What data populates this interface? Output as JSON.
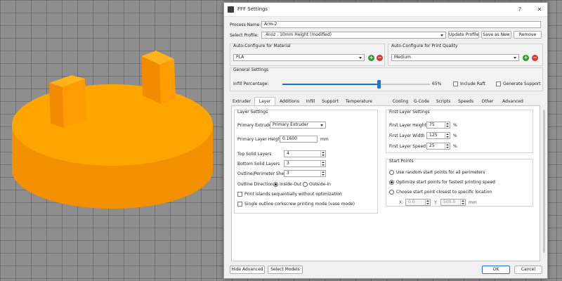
{
  "viewport": {
    "model_color": "#ffa500"
  },
  "window": {
    "title": "FFF Settings",
    "help": "?",
    "minimize": "—",
    "close": "✕"
  },
  "process": {
    "label": "Process Name:",
    "value": "Arm-2"
  },
  "profile": {
    "label": "Select Profile:",
    "value": ".4noz , 10mm Height (modified)",
    "update": "Update Profile",
    "save_as": "Save as New",
    "remove": "Remove"
  },
  "material": {
    "title": "Auto-Configure for Material",
    "value": "PLA"
  },
  "quality": {
    "title": "Auto-Configure for Print Quality",
    "value": "Medium"
  },
  "general": {
    "title": "General Settings",
    "infill_label": "Infill Percentage:",
    "infill_value": "65%",
    "infill_fraction": 0.65,
    "include_raft": "Include Raft",
    "generate_support": "Generate Support"
  },
  "tabs": [
    "Extruder",
    "Layer",
    "Additions",
    "Infill",
    "Support",
    "Temperature",
    "Cooling",
    "G-Code",
    "Scripts",
    "Speeds",
    "Other",
    "Advanced"
  ],
  "layer_settings": {
    "title": "Layer Settings",
    "primary_extruder_label": "Primary Extruder",
    "primary_extruder_value": "Primary Extruder",
    "layer_height_label": "Primary Layer Height",
    "layer_height_value": "0.1600",
    "layer_height_unit": "mm",
    "top_label": "Top Solid Layers",
    "top_value": "4",
    "bottom_label": "Bottom Solid Layers",
    "bottom_value": "3",
    "shells_label": "Outline/Perimeter Shells",
    "shells_value": "3",
    "direction_label": "Outline Direction:",
    "inside_out": "Inside-Out",
    "outside_in": "Outside-In",
    "islands": "Print islands sequentially without optimization",
    "vase": "Single outline corkscrew printing mode (vase mode)"
  },
  "first_layer": {
    "title": "First Layer Settings",
    "height_label": "First Layer Height",
    "height_value": "75",
    "width_label": "First Layer Width",
    "width_value": "125",
    "speed_label": "First Layer Speed",
    "speed_value": "25",
    "unit": "%"
  },
  "start_points": {
    "title": "Start Points",
    "opt1": "Use random start points for all perimeters",
    "opt2": "Optimize start points for fastest printing speed",
    "opt3": "Choose start point closest to specific location",
    "x_label": "X:",
    "x_value": "0.0",
    "y_label": "Y:",
    "y_value": "500.0",
    "unit": "mm"
  },
  "footer": {
    "hide_advanced": "Hide Advanced",
    "select_models": "Select Models",
    "ok": "OK",
    "cancel": "Cancel"
  }
}
